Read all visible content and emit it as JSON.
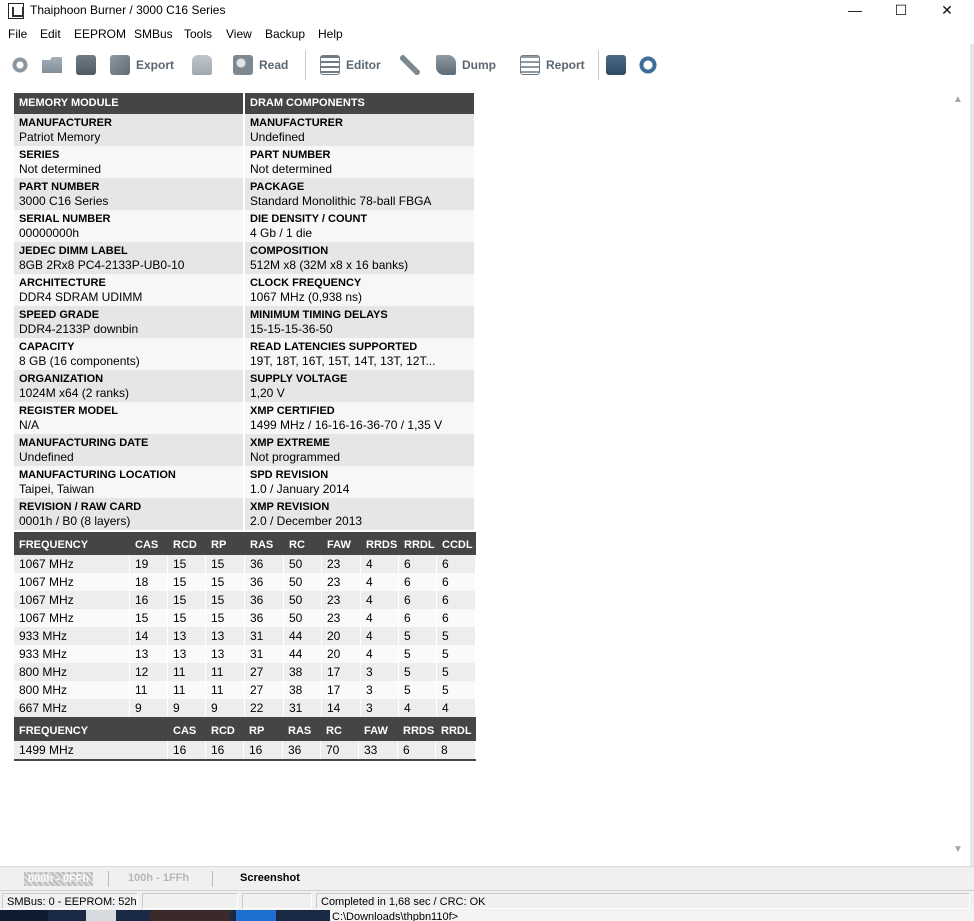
{
  "window": {
    "title": "Thaiphoon Burner / 3000 C16 Series",
    "minimize": "—",
    "maximize": "☐",
    "close": "✕"
  },
  "menu": [
    "File",
    "Edit",
    "EEPROM",
    "SMBus",
    "Tools",
    "View",
    "Backup",
    "Help"
  ],
  "toolbar": {
    "export": "Export",
    "read": "Read",
    "editor": "Editor",
    "dump": "Dump",
    "report": "Report"
  },
  "module": {
    "header_left": "MEMORY MODULE",
    "header_right": "DRAM COMPONENTS",
    "rows": [
      {
        "l_label": "MANUFACTURER",
        "l_value": "Patriot Memory",
        "r_label": "MANUFACTURER",
        "r_value": "Undefined"
      },
      {
        "l_label": "SERIES",
        "l_value": "Not determined",
        "r_label": "PART NUMBER",
        "r_value": "Not determined"
      },
      {
        "l_label": "PART NUMBER",
        "l_value": "3000 C16 Series",
        "r_label": "PACKAGE",
        "r_value": "Standard Monolithic 78-ball FBGA"
      },
      {
        "l_label": "SERIAL NUMBER",
        "l_value": "00000000h",
        "r_label": "DIE DENSITY / COUNT",
        "r_value": "4 Gb / 1 die"
      },
      {
        "l_label": "JEDEC DIMM LABEL",
        "l_value": "8GB 2Rx8 PC4-2133P-UB0-10",
        "r_label": "COMPOSITION",
        "r_value": "512M x8 (32M x8 x 16 banks)"
      },
      {
        "l_label": "ARCHITECTURE",
        "l_value": "DDR4 SDRAM UDIMM",
        "r_label": "CLOCK FREQUENCY",
        "r_value": "1067 MHz (0,938 ns)"
      },
      {
        "l_label": "SPEED GRADE",
        "l_value": "DDR4-2133P downbin",
        "r_label": "MINIMUM TIMING DELAYS",
        "r_value": "15-15-15-36-50"
      },
      {
        "l_label": "CAPACITY",
        "l_value": "8 GB (16 components)",
        "r_label": "READ LATENCIES SUPPORTED",
        "r_value": "19T, 18T, 16T, 15T, 14T, 13T, 12T..."
      },
      {
        "l_label": "ORGANIZATION",
        "l_value": "1024M x64 (2 ranks)",
        "r_label": "SUPPLY VOLTAGE",
        "r_value": "1,20 V"
      },
      {
        "l_label": "REGISTER MODEL",
        "l_value": "N/A",
        "r_label": "XMP CERTIFIED",
        "r_value": "1499 MHz / 16-16-16-36-70 / 1,35 V"
      },
      {
        "l_label": "MANUFACTURING DATE",
        "l_value": "Undefined",
        "r_label": "XMP EXTREME",
        "r_value": "Not programmed"
      },
      {
        "l_label": "MANUFACTURING LOCATION",
        "l_value": "Taipei, Taiwan",
        "r_label": "SPD REVISION",
        "r_value": "1.0 / January 2014"
      },
      {
        "l_label": "REVISION / RAW CARD",
        "l_value": "0001h / B0 (8 layers)",
        "r_label": "XMP REVISION",
        "r_value": "2.0 / December 2013"
      }
    ]
  },
  "jedec_timings": {
    "headers": [
      "FREQUENCY",
      "CAS",
      "RCD",
      "RP",
      "RAS",
      "RC",
      "FAW",
      "RRDS",
      "RRDL",
      "CCDL"
    ],
    "rows": [
      [
        "1067 MHz",
        "19",
        "15",
        "15",
        "36",
        "50",
        "23",
        "4",
        "6",
        "6"
      ],
      [
        "1067 MHz",
        "18",
        "15",
        "15",
        "36",
        "50",
        "23",
        "4",
        "6",
        "6"
      ],
      [
        "1067 MHz",
        "16",
        "15",
        "15",
        "36",
        "50",
        "23",
        "4",
        "6",
        "6"
      ],
      [
        "1067 MHz",
        "15",
        "15",
        "15",
        "36",
        "50",
        "23",
        "4",
        "6",
        "6"
      ],
      [
        "933 MHz",
        "14",
        "13",
        "13",
        "31",
        "44",
        "20",
        "4",
        "5",
        "5"
      ],
      [
        "933 MHz",
        "13",
        "13",
        "13",
        "31",
        "44",
        "20",
        "4",
        "5",
        "5"
      ],
      [
        "800 MHz",
        "12",
        "11",
        "11",
        "27",
        "38",
        "17",
        "3",
        "5",
        "5"
      ],
      [
        "800 MHz",
        "11",
        "11",
        "11",
        "27",
        "38",
        "17",
        "3",
        "5",
        "5"
      ],
      [
        "667 MHz",
        "9",
        "9",
        "9",
        "22",
        "31",
        "14",
        "3",
        "4",
        "4"
      ]
    ]
  },
  "xmp_timings": {
    "headers": [
      "FREQUENCY",
      "CAS",
      "RCD",
      "RP",
      "RAS",
      "RC",
      "FAW",
      "RRDS",
      "RRDL"
    ],
    "rows": [
      [
        "1499 MHz",
        "16",
        "16",
        "16",
        "36",
        "70",
        "33",
        "6",
        "8"
      ]
    ]
  },
  "status_tabs": {
    "tab1": "000h - 0FFh",
    "tab2": "100h - 1FFh",
    "tab3": "Screenshot"
  },
  "statusbar": {
    "smbus": "SMBus: 0 - EEPROM: 52h",
    "result": "Completed in 1,68 sec / CRC: OK"
  },
  "taskbar": {
    "path": "C:\\Downloads\\thpbn110f>"
  }
}
